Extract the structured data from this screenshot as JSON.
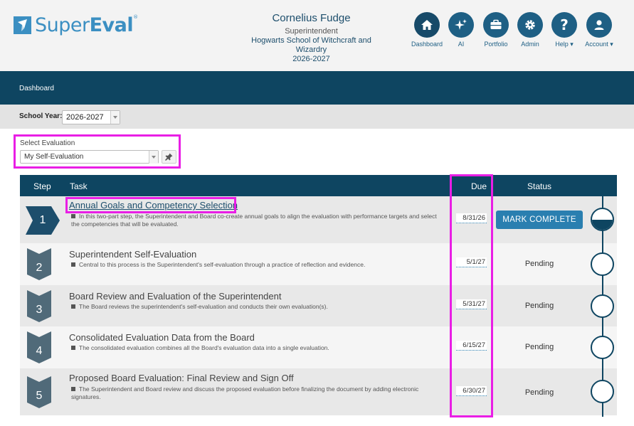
{
  "brand": {
    "name_light": "Super",
    "name_bold": "Eval",
    "reg": "®"
  },
  "user": {
    "name": "Cornelius Fudge",
    "role": "Superintendent",
    "school": "Hogwarts School of Witchcraft and Wizardry",
    "year": "2026-2027"
  },
  "nav": [
    {
      "label": "Dashboard",
      "icon": "home-icon"
    },
    {
      "label": "AI",
      "icon": "sparkle-icon"
    },
    {
      "label": "Portfolio",
      "icon": "briefcase-icon"
    },
    {
      "label": "Admin",
      "icon": "gear-icon"
    },
    {
      "label": "Help",
      "icon": "question-icon"
    },
    {
      "label": "Account",
      "icon": "user-icon"
    }
  ],
  "breadcrumb": "Dashboard",
  "school_year": {
    "label": "School Year:",
    "value": "2026-2027"
  },
  "evaluation": {
    "label": "Select Evaluation",
    "value": "My Self-Evaluation"
  },
  "table": {
    "headers": {
      "step": "Step",
      "task": "Task",
      "due": "Due",
      "status": "Status"
    },
    "rows": [
      {
        "step": "1",
        "title": "Annual Goals and Competency Selection",
        "desc": "In this two-part step, the Superintendent and Board co-create annual goals to align the evaluation with performance targets and select the competencies that will be evaluated.",
        "due": "8/31/26",
        "status": "MARK COMPLETE"
      },
      {
        "step": "2",
        "title": "Superintendent Self-Evaluation",
        "desc": "Central to this process is the Superintendent's self-evaluation through a practice of reflection and evidence.",
        "due": "5/1/27",
        "status": "Pending"
      },
      {
        "step": "3",
        "title": "Board Review and Evaluation of the Superintendent",
        "desc": "The Board reviews the superintendent's self-evaluation and conducts their own evaluation(s).",
        "due": "5/31/27",
        "status": "Pending"
      },
      {
        "step": "4",
        "title": "Consolidated Evaluation Data from the Board",
        "desc": "The consolidated evaluation combines all the Board's evaluation data into a single evaluation.",
        "due": "6/15/27",
        "status": "Pending"
      },
      {
        "step": "5",
        "title": "Proposed Board Evaluation: Final Review and Sign Off",
        "desc": "The Superintendent and Board review and discuss the proposed evaluation before finalizing the document by adding electronic signatures.",
        "due": "6/30/27",
        "status": "Pending"
      }
    ]
  },
  "colors": {
    "navy": "#0e4561",
    "accent": "#2a7fb0",
    "highlight": "#e91ee5"
  }
}
